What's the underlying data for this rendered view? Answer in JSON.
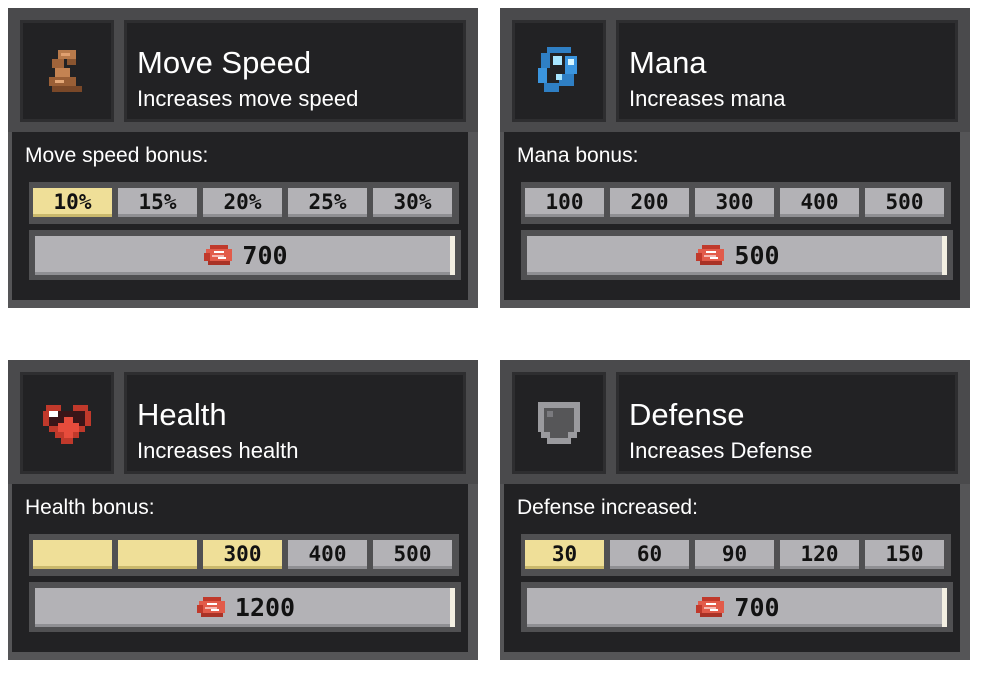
{
  "upgrades": [
    {
      "icon": "boot-icon",
      "title": "Move Speed",
      "description": "Increases move speed",
      "bonus_label": "Move speed bonus:",
      "options": [
        {
          "label": "10%",
          "selected": true
        },
        {
          "label": "15%",
          "selected": false
        },
        {
          "label": "20%",
          "selected": false
        },
        {
          "label": "25%",
          "selected": false
        },
        {
          "label": "30%",
          "selected": false
        }
      ],
      "cost_icon": "meat-icon",
      "cost": "700"
    },
    {
      "icon": "mana-orb-icon",
      "title": "Mana",
      "description": "Increases mana",
      "bonus_label": "Mana bonus:",
      "options": [
        {
          "label": "100",
          "selected": false
        },
        {
          "label": "200",
          "selected": false
        },
        {
          "label": "300",
          "selected": false
        },
        {
          "label": "400",
          "selected": false
        },
        {
          "label": "500",
          "selected": false
        }
      ],
      "cost_icon": "meat-icon",
      "cost": "500"
    },
    {
      "icon": "heart-plus-icon",
      "title": "Health",
      "description": "Increases health",
      "bonus_label": "Health bonus:",
      "options": [
        {
          "label": "",
          "selected": true
        },
        {
          "label": "",
          "selected": true
        },
        {
          "label": "300",
          "selected": true
        },
        {
          "label": "400",
          "selected": false
        },
        {
          "label": "500",
          "selected": false
        }
      ],
      "cost_icon": "meat-icon",
      "cost": "1200"
    },
    {
      "icon": "shield-icon",
      "title": "Defense",
      "description": "Increases Defense",
      "bonus_label": "Defense increased:",
      "options": [
        {
          "label": "30",
          "selected": true
        },
        {
          "label": "60",
          "selected": false
        },
        {
          "label": "90",
          "selected": false
        },
        {
          "label": "120",
          "selected": false
        },
        {
          "label": "150",
          "selected": false
        }
      ],
      "cost_icon": "meat-icon",
      "cost": "700"
    }
  ],
  "colors": {
    "selected": "#efdf98",
    "unselected": "#b3b2b6",
    "panel_dark": "#222224",
    "frame": "#555557"
  }
}
